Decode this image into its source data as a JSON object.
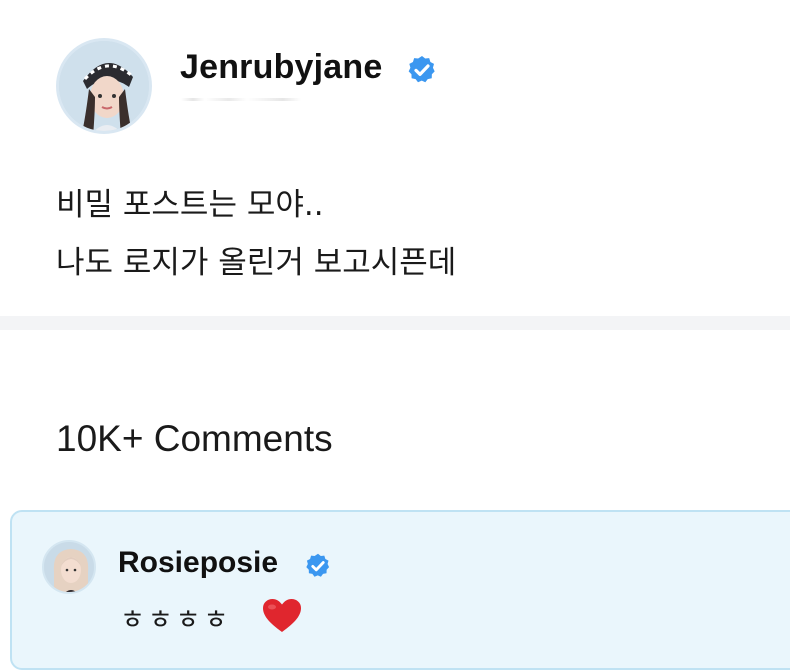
{
  "post": {
    "username": "Jenrubyjane",
    "lines": [
      "비밀 포스트는 모야..",
      "나도 로지가 올린거 보고시픈데"
    ]
  },
  "comments": {
    "count_label": "10K+ Comments",
    "items": [
      {
        "username": "Rosieposie",
        "text": "ㅎㅎㅎㅎ",
        "emoji": "heart-icon"
      }
    ]
  },
  "colors": {
    "verified": "#3b97f0",
    "card_bg": "#eaf6fc",
    "card_border": "#bfe2f3",
    "heart": "#e0262e"
  }
}
